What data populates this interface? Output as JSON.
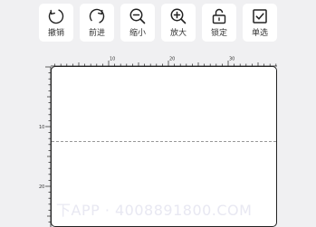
{
  "toolbar": {
    "items": [
      {
        "id": "undo",
        "label": "撤销",
        "icon": "undo-icon"
      },
      {
        "id": "redo",
        "label": "前进",
        "icon": "redo-icon"
      },
      {
        "id": "zoom-out",
        "label": "缩小",
        "icon": "zoom-out-icon"
      },
      {
        "id": "zoom-in",
        "label": "放大",
        "icon": "zoom-in-icon"
      },
      {
        "id": "lock",
        "label": "锁定",
        "icon": "unlock-icon"
      },
      {
        "id": "single-select",
        "label": "单选",
        "icon": "checkbox-icon"
      }
    ]
  },
  "ruler": {
    "top_labels": [
      "10",
      "20",
      "30"
    ],
    "left_labels": [
      "10",
      "20"
    ]
  },
  "watermark": {
    "text": "下APP · 4008891800.COM"
  },
  "colors": {
    "background": "#f0f0f2",
    "tool_bg": "#ffffff",
    "icon": "#222222",
    "guide_line": "#777777"
  }
}
